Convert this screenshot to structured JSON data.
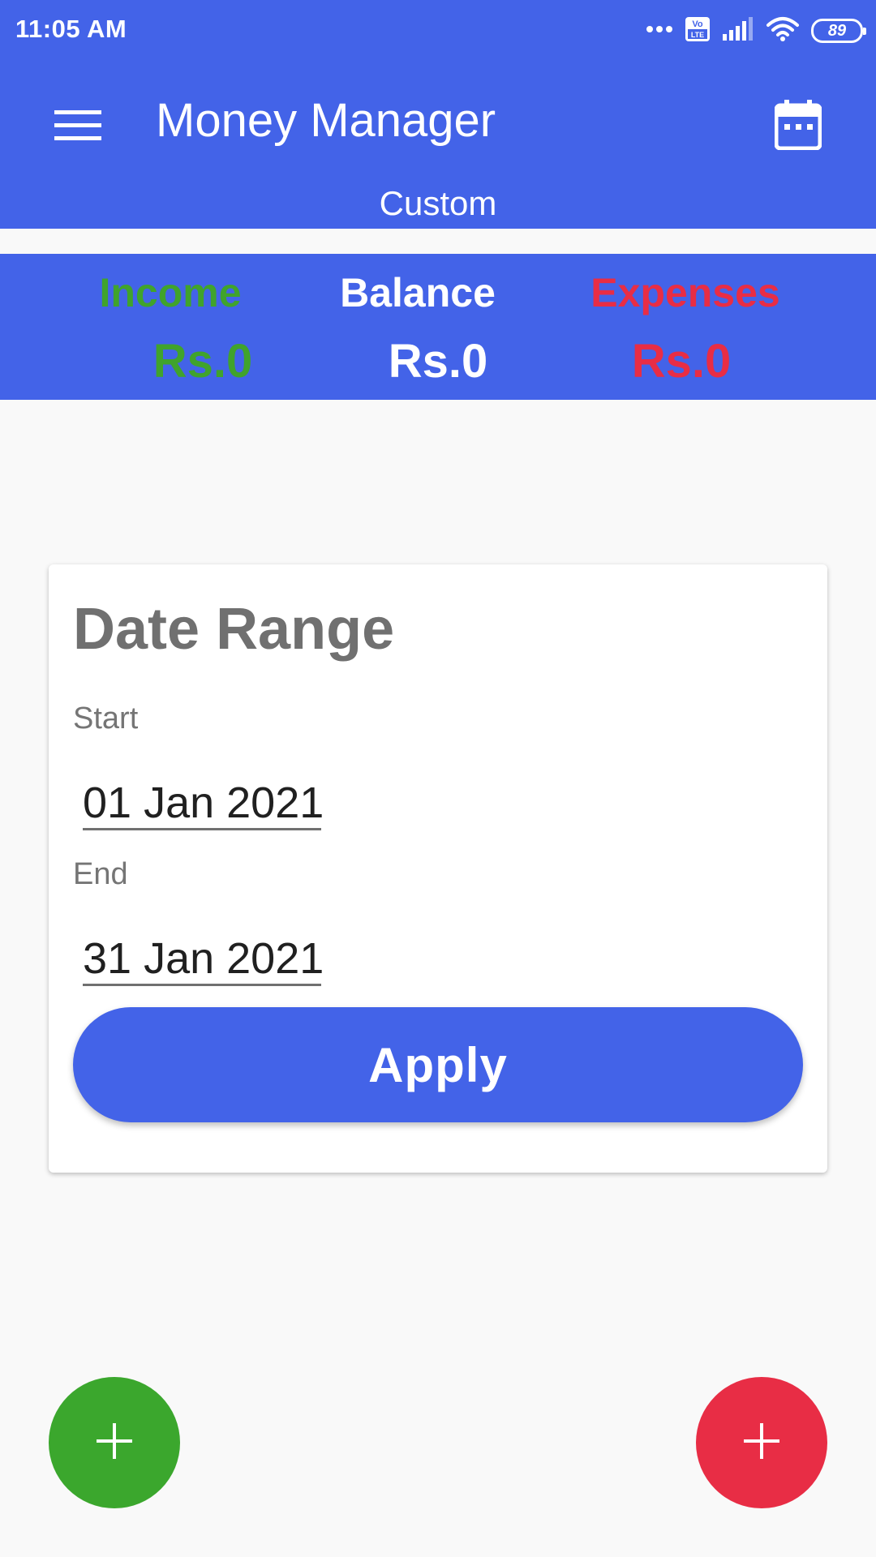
{
  "status_bar": {
    "time": "11:05 AM",
    "battery": "89",
    "icons": [
      "more-dots-icon",
      "volte-icon",
      "signal-icon",
      "wifi-icon",
      "battery-icon"
    ]
  },
  "app_bar": {
    "title": "Money Manager",
    "period": "Custom",
    "menu_icon": "hamburger-menu-icon",
    "calendar_icon": "calendar-icon"
  },
  "summary": {
    "income_label": "Income",
    "income_value": "Rs.0",
    "balance_label": "Balance",
    "balance_value": "Rs.0",
    "expenses_label": "Expenses",
    "expenses_value": "Rs.0"
  },
  "date_range": {
    "title": "Date Range",
    "start_label": "Start",
    "start_value": "01 Jan 2021",
    "end_label": "End",
    "end_value": "31 Jan 2021",
    "apply_label": "Apply"
  },
  "fabs": {
    "add_income_icon": "plus-icon",
    "add_expense_icon": "plus-icon"
  },
  "colors": {
    "primary": "#4363e8",
    "income": "#40a32c",
    "expense": "#e82d45",
    "background": "#f9f9f9"
  }
}
